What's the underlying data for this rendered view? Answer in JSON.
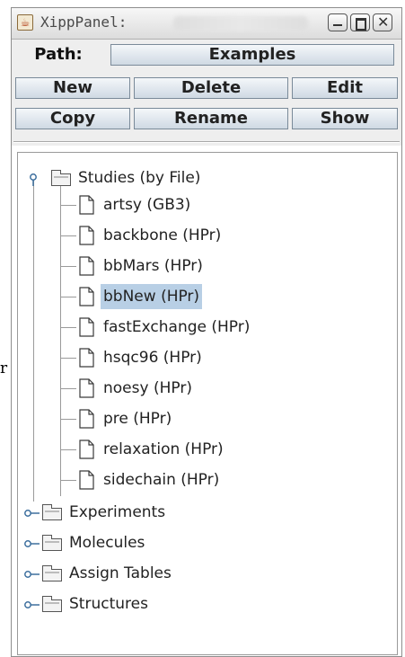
{
  "stray_char": "r",
  "window": {
    "title": "XippPanel:",
    "controls": {
      "minimize": "minimize-icon",
      "maximize": "maximize-icon",
      "close": "close-icon"
    }
  },
  "toolbar": {
    "path_label": "Path:",
    "path_value": "Examples",
    "buttons": [
      "New",
      "Delete",
      "Edit",
      "Copy",
      "Rename",
      "Show"
    ]
  },
  "tree": {
    "root": "Studies (by File)",
    "children": [
      "artsy (GB3)",
      "backbone (HPr)",
      "bbMars (HPr)",
      "bbNew (HPr)",
      "fastExchange (HPr)",
      "hsqc96 (HPr)",
      "noesy (HPr)",
      "pre (HPr)",
      "relaxation (HPr)",
      "sidechain (HPr)"
    ],
    "selected_index": 3,
    "collapsed": [
      "Experiments",
      "Molecules",
      "Assign Tables",
      "Structures"
    ]
  },
  "colors": {
    "selection": "#b8cfe5",
    "button_top": "#f4f7fa",
    "button_bottom": "#cfd9e3"
  }
}
